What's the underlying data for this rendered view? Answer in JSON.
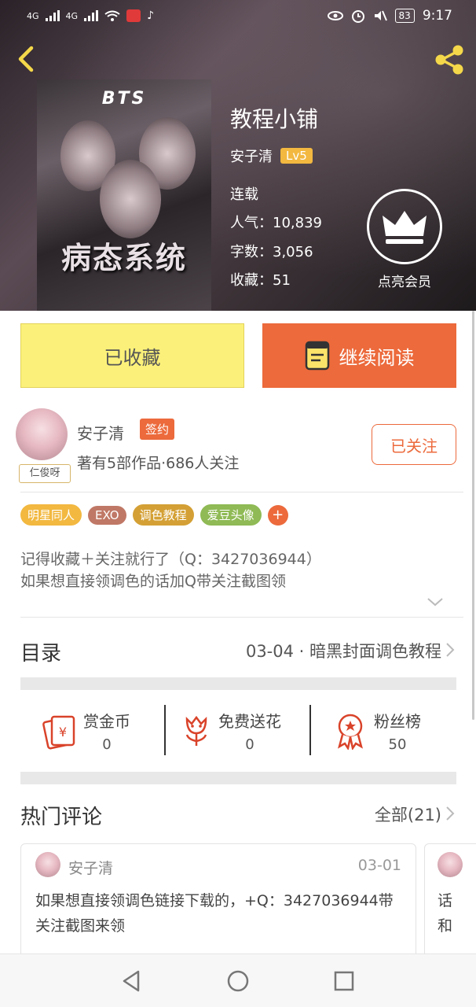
{
  "status_bar": {
    "signal1": "4G",
    "signal2": "4G",
    "battery": "83",
    "time": "9:17"
  },
  "book": {
    "title": "教程小铺",
    "author": "安子清",
    "level": "Lv5",
    "status": "连载",
    "popularity": "人气：10,839",
    "words": "字数：3,056",
    "favorites": "收藏：51",
    "cover_title": "BTS",
    "cover_big_text": "病态系统"
  },
  "vip": {
    "label": "点亮会员"
  },
  "actions": {
    "favorited_label": "已收藏",
    "continue_label": "继续阅读"
  },
  "author_card": {
    "name": "安子清",
    "sign_badge": "签约",
    "avatar_tag": "仁俊呀",
    "meta": "著有5部作品·686人关注",
    "follow_label": "已关注"
  },
  "tags": [
    {
      "label": "明星同人",
      "color": "#f2b840"
    },
    {
      "label": "EXO",
      "color": "#c07866"
    },
    {
      "label": "调色教程",
      "color": "#d4a035"
    },
    {
      "label": "爱豆头像",
      "color": "#8fba55"
    }
  ],
  "tags_more": "+",
  "description": {
    "line1": "记得收藏＋关注就行了（Q：3427036944）",
    "line2": "如果想直接领调色的话加Q带关注截图领"
  },
  "toc": {
    "label": "目录",
    "latest": "03-04 · 暗黑封面调色教程"
  },
  "rewards": [
    {
      "label": "赏金币",
      "value": "0"
    },
    {
      "label": "免费送花",
      "value": "0"
    },
    {
      "label": "粉丝榜",
      "value": "50"
    }
  ],
  "hot_comments": {
    "label": "热门评论",
    "all_label": "全部(21)",
    "items": [
      {
        "user": "安子清",
        "date": "03-01",
        "text": "如果想直接领调色链接下载的，+Q：3427036944带关注截图来领"
      }
    ],
    "partial_text_line1": "话",
    "partial_text_line2": "和"
  },
  "colors": {
    "accent": "#ec6a3c",
    "yellow": "#fbf17a",
    "level_badge": "#f2b840"
  }
}
